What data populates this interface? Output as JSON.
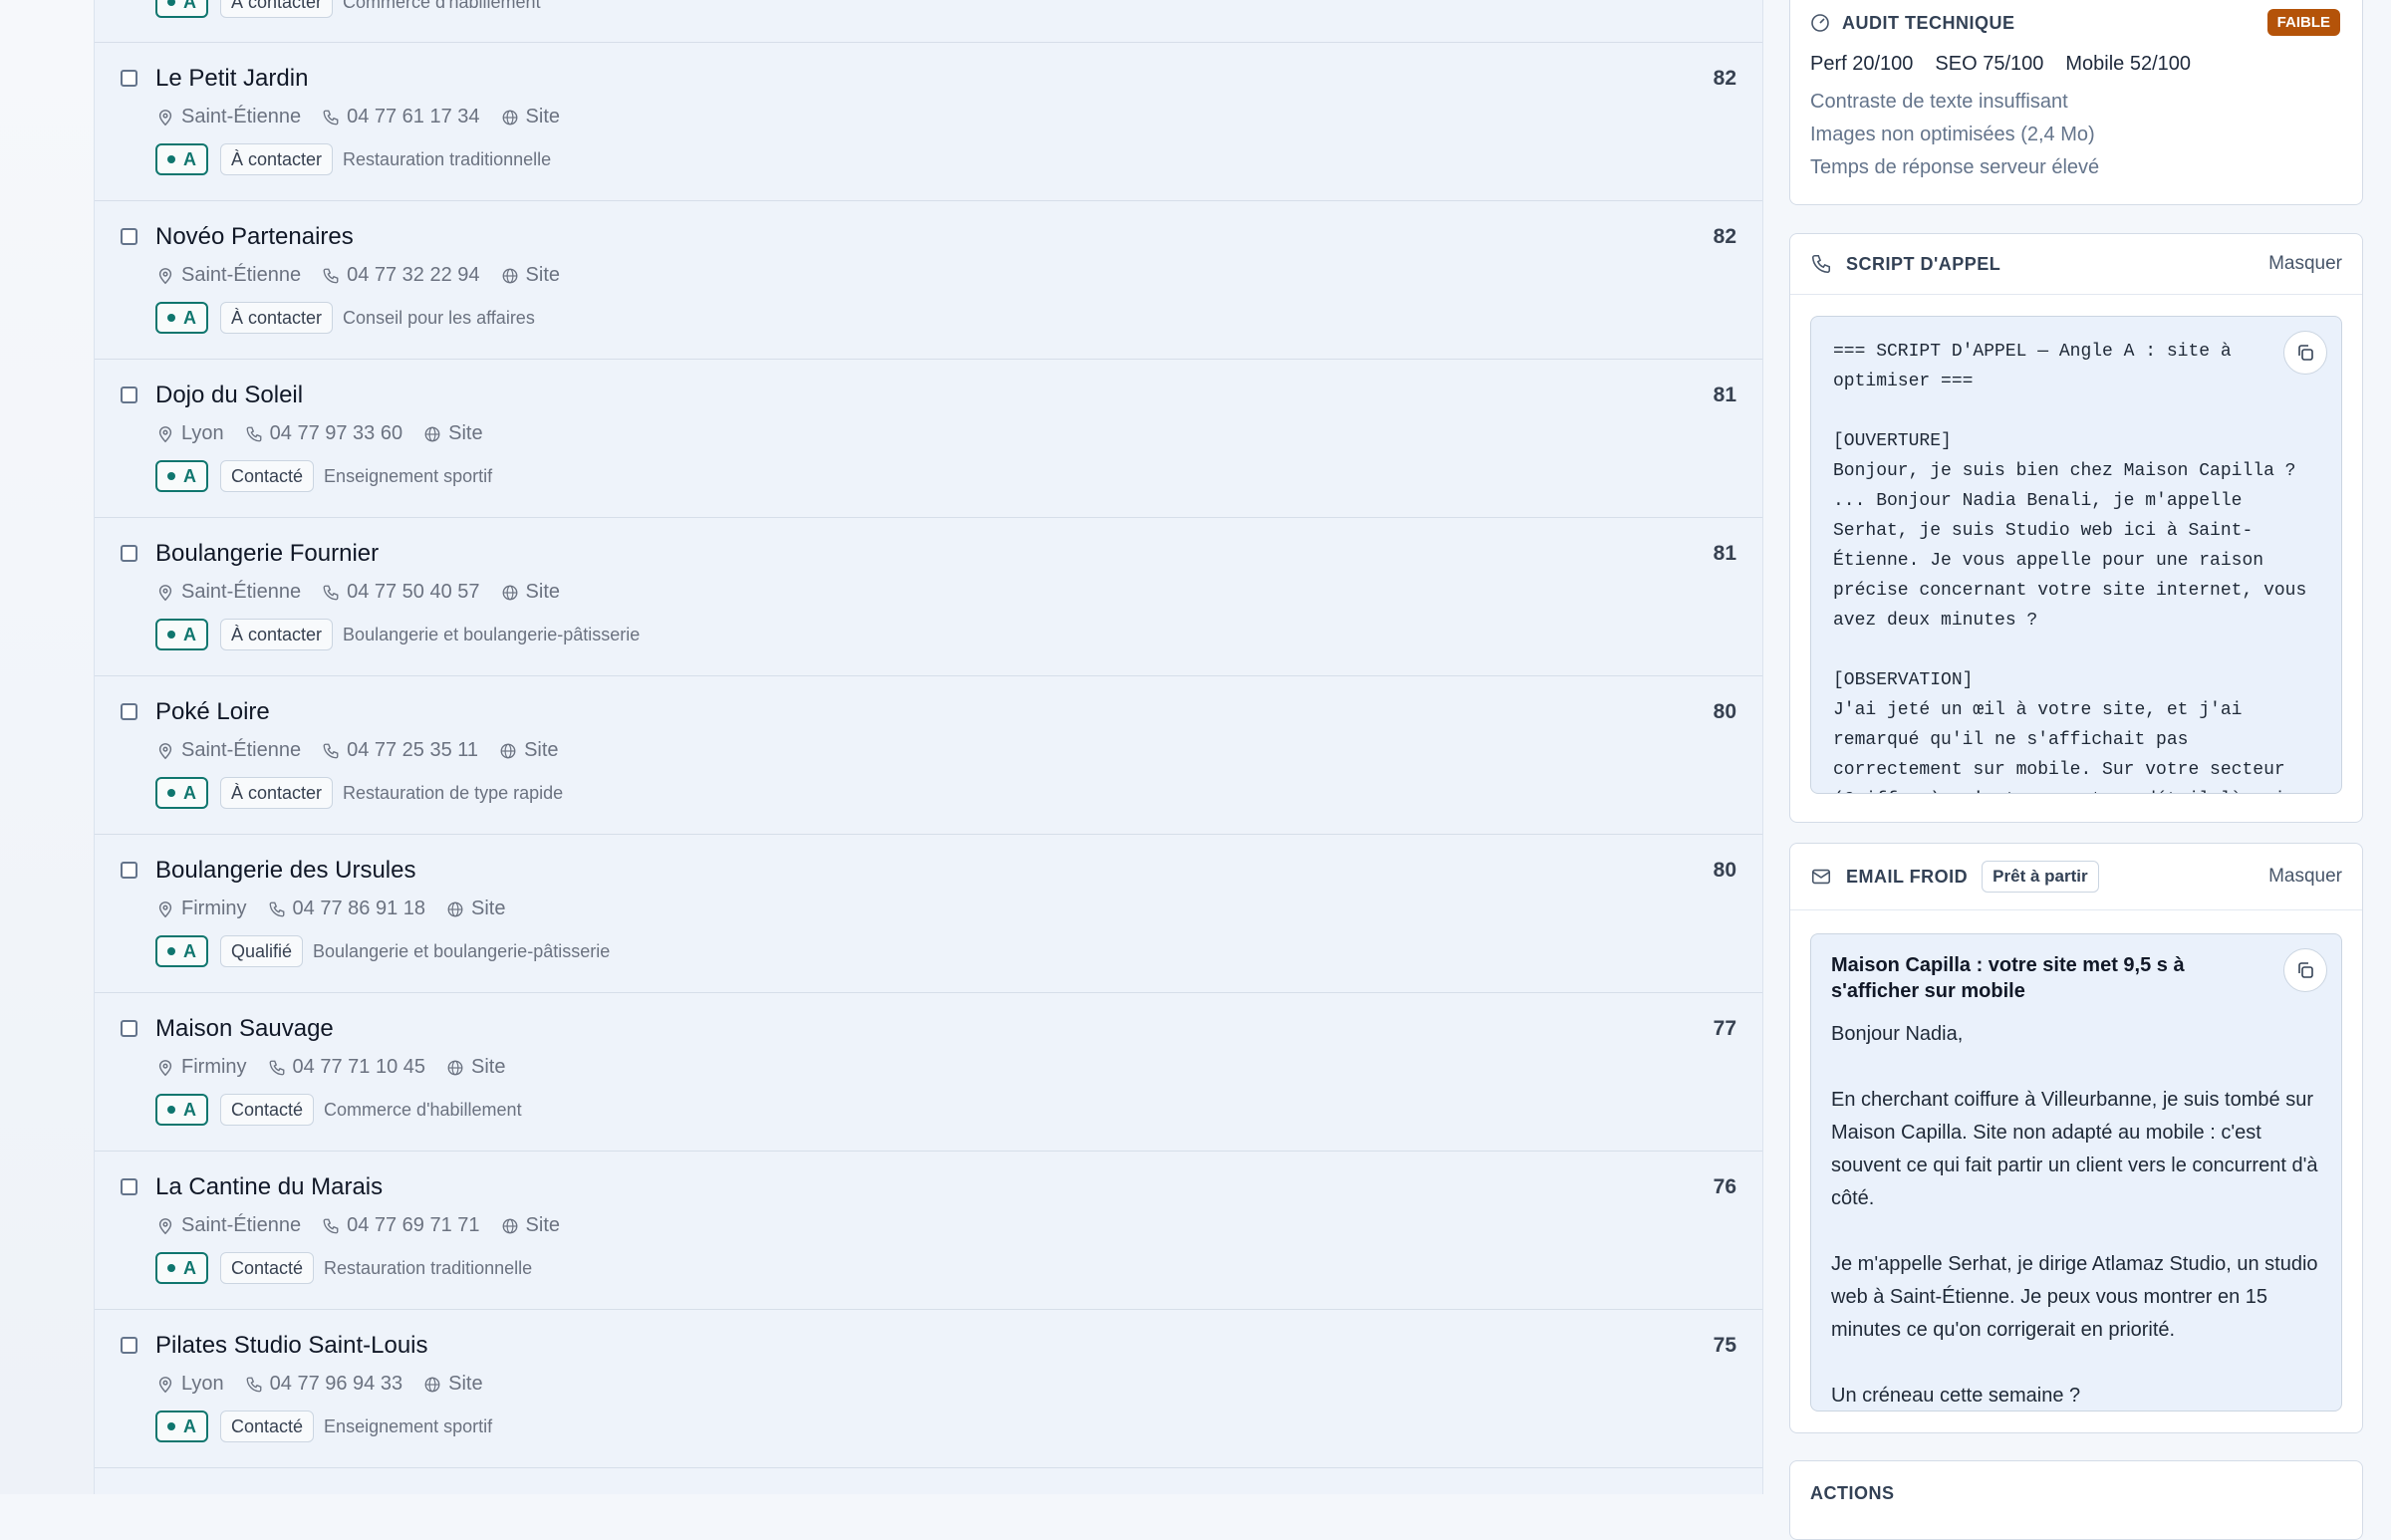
{
  "leads": {
    "partial_top": {
      "status": "À contacter",
      "category": "Commerce d'habillement",
      "angle": "A"
    },
    "items": [
      {
        "name": "Le Petit Jardin",
        "city": "Saint-Étienne",
        "phone": "04 77 61 17 34",
        "site": "Site",
        "angle": "A",
        "status": "À contacter",
        "category": "Restauration traditionnelle",
        "score": "82"
      },
      {
        "name": "Novéo Partenaires",
        "city": "Saint-Étienne",
        "phone": "04 77 32 22 94",
        "site": "Site",
        "angle": "A",
        "status": "À contacter",
        "category": "Conseil pour les affaires",
        "score": "82"
      },
      {
        "name": "Dojo du Soleil",
        "city": "Lyon",
        "phone": "04 77 97 33 60",
        "site": "Site",
        "angle": "A",
        "status": "Contacté",
        "category": "Enseignement sportif",
        "score": "81"
      },
      {
        "name": "Boulangerie Fournier",
        "city": "Saint-Étienne",
        "phone": "04 77 50 40 57",
        "site": "Site",
        "angle": "A",
        "status": "À contacter",
        "category": "Boulangerie et boulangerie-pâtisserie",
        "score": "81"
      },
      {
        "name": "Poké Loire",
        "city": "Saint-Étienne",
        "phone": "04 77 25 35 11",
        "site": "Site",
        "angle": "A",
        "status": "À contacter",
        "category": "Restauration de type rapide",
        "score": "80"
      },
      {
        "name": "Boulangerie des Ursules",
        "city": "Firminy",
        "phone": "04 77 86 91 18",
        "site": "Site",
        "angle": "A",
        "status": "Qualifié",
        "category": "Boulangerie et boulangerie-pâtisserie",
        "score": "80"
      },
      {
        "name": "Maison Sauvage",
        "city": "Firminy",
        "phone": "04 77 71 10 45",
        "site": "Site",
        "angle": "A",
        "status": "Contacté",
        "category": "Commerce d'habillement",
        "score": "77"
      },
      {
        "name": "La Cantine du Marais",
        "city": "Saint-Étienne",
        "phone": "04 77 69 71 71",
        "site": "Site",
        "angle": "A",
        "status": "Contacté",
        "category": "Restauration traditionnelle",
        "score": "76"
      },
      {
        "name": "Pilates Studio Saint-Louis",
        "city": "Lyon",
        "phone": "04 77 96 94 33",
        "site": "Site",
        "angle": "A",
        "status": "Contacté",
        "category": "Enseignement sportif",
        "score": "75"
      }
    ]
  },
  "audit": {
    "title": "AUDIT TECHNIQUE",
    "badge": "FAIBLE",
    "perf": "Perf 20/100",
    "seo": "SEO 75/100",
    "mobile": "Mobile 52/100",
    "issues": [
      "Contraste de texte insuffisant",
      "Images non optimisées (2,4 Mo)",
      "Temps de réponse serveur élevé"
    ]
  },
  "script": {
    "title": "SCRIPT D'APPEL",
    "hide_label": "Masquer",
    "text": "=== SCRIPT D'APPEL — Angle A : site à optimiser ===\n\n[OUVERTURE]\nBonjour, je suis bien chez Maison Capilla ? ... Bonjour Nadia Benali, je m'appelle Serhat, je suis Studio web ici à Saint-Étienne. Je vous appelle pour une raison précise concernant votre site internet, vous avez deux minutes ?\n\n[OBSERVATION]\nJ'ai jeté un œil à votre site, et j'ai remarqué qu'il ne s'affichait pas correctement sur mobile. Sur votre secteur (Coiffure), c'est souvent ce détail là qui"
  },
  "email": {
    "title": "EMAIL FROID",
    "status": "Prêt à partir",
    "hide_label": "Masquer",
    "subject": "Maison Capilla : votre site met 9,5 s à s'afficher sur mobile",
    "body": "Bonjour Nadia,\n\nEn cherchant coiffure à Villeurbanne, je suis tombé sur Maison Capilla. Site non adapté au mobile : c'est souvent ce qui fait partir un client vers le concurrent d'à côté.\n\nJe m'appelle Serhat, je dirige Atlamaz Studio, un studio web à Saint-Étienne. Je peux vous montrer en 15 minutes ce qu'on corrigerait en priorité.\n\nUn créneau cette semaine ?"
  },
  "actions": {
    "title": "ACTIONS"
  },
  "colors": {
    "accent": "#0f766e",
    "badge_faible": "#b45309"
  }
}
